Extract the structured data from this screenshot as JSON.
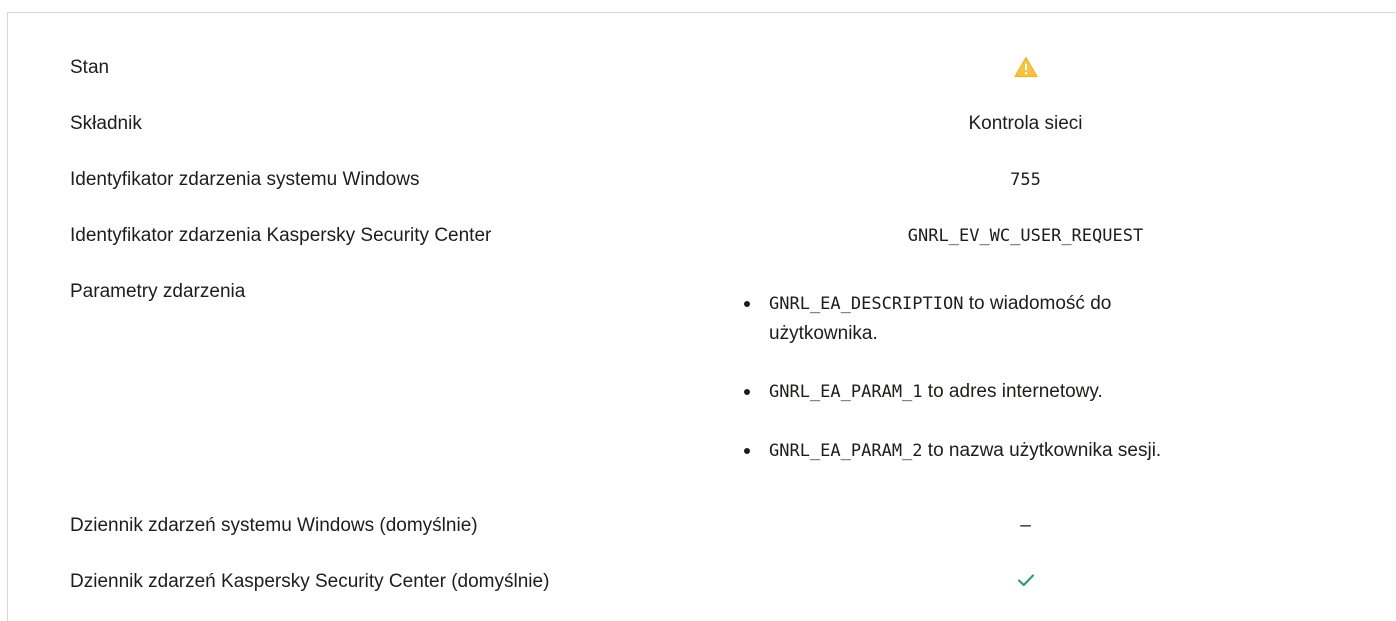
{
  "colors": {
    "warning": "#f5c341",
    "success": "#2e9e6b",
    "border": "#d6d6d6"
  },
  "rows": {
    "status": {
      "label": "Stan",
      "icon": "warning-icon"
    },
    "component": {
      "label": "Składnik",
      "value": "Kontrola sieci"
    },
    "windows_event_id": {
      "label": "Identyfikator zdarzenia systemu Windows",
      "value": "755"
    },
    "ksc_event_id": {
      "label": "Identyfikator zdarzenia Kaspersky Security Center",
      "value": "GNRL_EV_WC_USER_REQUEST"
    },
    "event_params": {
      "label": "Parametry zdarzenia",
      "items": [
        {
          "code": "GNRL_EA_DESCRIPTION",
          "text": " to wiadomość do użytkownika."
        },
        {
          "code": "GNRL_EA_PARAM_1",
          "text": " to adres internetowy."
        },
        {
          "code": "GNRL_EA_PARAM_2",
          "text": " to nazwa użytkownika sesji."
        }
      ]
    },
    "windows_log": {
      "label": "Dziennik zdarzeń systemu Windows (domyślnie)",
      "value": "–"
    },
    "ksc_log": {
      "label": "Dziennik zdarzeń Kaspersky Security Center (domyślnie)",
      "icon": "check-icon"
    }
  }
}
